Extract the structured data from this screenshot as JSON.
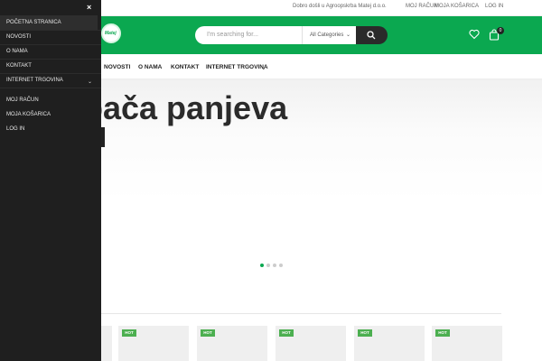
{
  "topbar": {
    "welcome": "Dobro došli u Agroopskrba Matej d.o.o.",
    "links": [
      "MOJ RAČUN",
      "MOJA KOŠARICA",
      "LOG IN"
    ]
  },
  "header": {
    "logo_text": "Matej",
    "search_placeholder": "I'm searching for...",
    "category_label": "All Categories",
    "cart_count": "0",
    "brand_color": "#0ba850"
  },
  "nav": {
    "items": [
      "NOVOSTI",
      "O NAMA",
      "KONTAKT",
      "INTERNET TRGOVINA"
    ]
  },
  "hero": {
    "title": "pača panjeva",
    "slides": 4,
    "active_slide": 1
  },
  "products": {
    "badges": [
      "HOT",
      "HOT",
      "HOT",
      "HOT",
      "HOT"
    ]
  },
  "drawer": {
    "close_symbol": "×",
    "items": [
      "POČETNA STRANICA",
      "NOVOSTI",
      "O NAMA",
      "KONTAKT",
      "INTERNET TRGOVINA"
    ],
    "account_items": [
      "MOJ RAČUN",
      "MOJA KOŠARICA",
      "LOG IN"
    ]
  }
}
